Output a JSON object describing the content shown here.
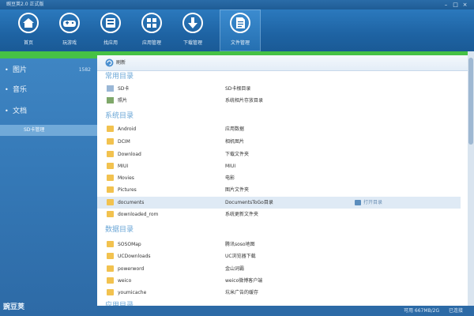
{
  "window": {
    "title": "豌豆荚2.0 正式版"
  },
  "toolbar": {
    "items": [
      {
        "id": "home",
        "label": "首页"
      },
      {
        "id": "games",
        "label": "玩游戏"
      },
      {
        "id": "apps",
        "label": "找应用"
      },
      {
        "id": "appmgr",
        "label": "应用管理"
      },
      {
        "id": "downloads",
        "label": "下载管理"
      },
      {
        "id": "files",
        "label": "文件管理",
        "active": true
      }
    ]
  },
  "sidebar": {
    "items": [
      {
        "label": "图片",
        "count": "1582"
      },
      {
        "label": "音乐"
      },
      {
        "label": "文档"
      }
    ],
    "subitem": "SD卡管理",
    "brand": "豌豆荚"
  },
  "main": {
    "refresh_label": "刷新",
    "sections": [
      {
        "title": "常用目录",
        "rows": [
          {
            "name": "SD卡",
            "desc": "SD卡根目录",
            "icon": "sdcard-icon"
          },
          {
            "name": "照片",
            "desc": "系统相片存放目录",
            "icon": "photo-icon"
          }
        ]
      },
      {
        "title": "系统目录",
        "rows": [
          {
            "name": "Android",
            "desc": "应用数据"
          },
          {
            "name": "DCIM",
            "desc": "相机图片"
          },
          {
            "name": "Download",
            "desc": "下载文件夹"
          },
          {
            "name": "MIUI",
            "desc": "MIUI"
          },
          {
            "name": "Movies",
            "desc": "电影"
          },
          {
            "name": "Pictures",
            "desc": "图片文件夹"
          },
          {
            "name": "documents",
            "desc": "DocumentsToGo目录",
            "selected": true,
            "action": "打开目录"
          },
          {
            "name": "downloaded_rom",
            "desc": "系统更新文件夹"
          }
        ]
      },
      {
        "title": "数据目录",
        "rows": [
          {
            "name": "SOSOMap",
            "desc": "腾讯soso地图"
          },
          {
            "name": "UCDownloads",
            "desc": "UC浏览器下载"
          },
          {
            "name": "powerword",
            "desc": "金山词霸"
          },
          {
            "name": "weico",
            "desc": "weico微博客户端"
          },
          {
            "name": "youmicache",
            "desc": "坑米广告的缓存"
          }
        ]
      },
      {
        "title": "应用目录",
        "rows": []
      }
    ]
  },
  "statusbar": {
    "storage": "可用 667MB/2G",
    "connection": "已连接"
  },
  "colors": {
    "toolbar": "#1e63a3",
    "sidebar": "#3579b7",
    "accent": "#46c145",
    "section": "#6aa6d6"
  }
}
